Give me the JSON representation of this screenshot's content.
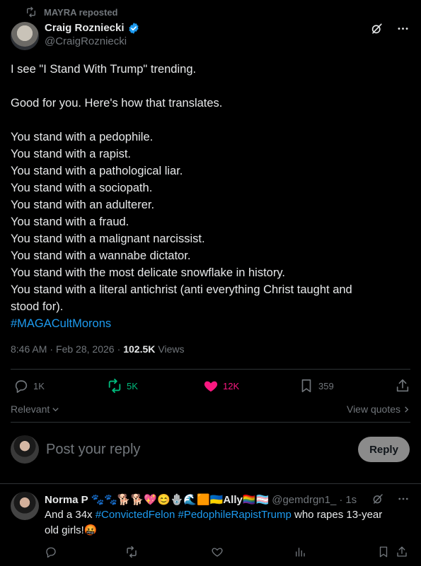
{
  "repost": {
    "icon": "repost-icon",
    "label": "MAYRA reposted"
  },
  "author": {
    "name": "Craig Rozniecki",
    "handle": "@CraigRozniecki",
    "verified_icon": "verified-badge-icon",
    "verified_color": "#1d9bf0"
  },
  "tweet": {
    "lines": [
      "I see \"I Stand With Trump\" trending.",
      "",
      "Good for you. Here's how that translates.",
      "",
      "You stand with a pedophile.",
      "You stand with a rapist.",
      "You stand with a pathological liar.",
      "You stand with a sociopath.",
      "You stand with an adulterer.",
      "You stand with a fraud.",
      "You stand with a malignant narcissist.",
      "You stand with a wannabe dictator.",
      "You stand with the most delicate snowflake in history.",
      "You stand with a literal antichrist (anti everything Christ taught and",
      "stood for)."
    ],
    "hashtag": "#MAGACultMorons",
    "time": "8:46 AM",
    "date": "Feb 28, 2026",
    "views_count": "102.5K",
    "views_label": "Views"
  },
  "engagement": {
    "replies": "1K",
    "reposts": "5K",
    "likes": "12K",
    "bookmarks": "359",
    "repost_color": "#00ba7c",
    "like_color": "#f91880"
  },
  "sort": {
    "relevant": "Relevant",
    "view_quotes": "View quotes"
  },
  "composer": {
    "placeholder": "Post your reply",
    "button": "Reply"
  },
  "reply": {
    "name": "Norma P 🐾🐾🐕🐕💖😊🪬🌊🟧🇺🇦Ally🏳️‍🌈🏳️‍⚧️",
    "handle": "@gemdrgn1_",
    "time": "1s",
    "text_prefix": "And a 34x ",
    "tag1": "#ConvictedFelon",
    "tag2": "#PedophileRapistTrump",
    "text_suffix": "  who rapes 13-year old girls!🤬"
  },
  "colors": {
    "background": "#000000",
    "text": "#e7e9ea",
    "muted": "#71767b",
    "link": "#1d9bf0",
    "divider": "#2f3336"
  }
}
